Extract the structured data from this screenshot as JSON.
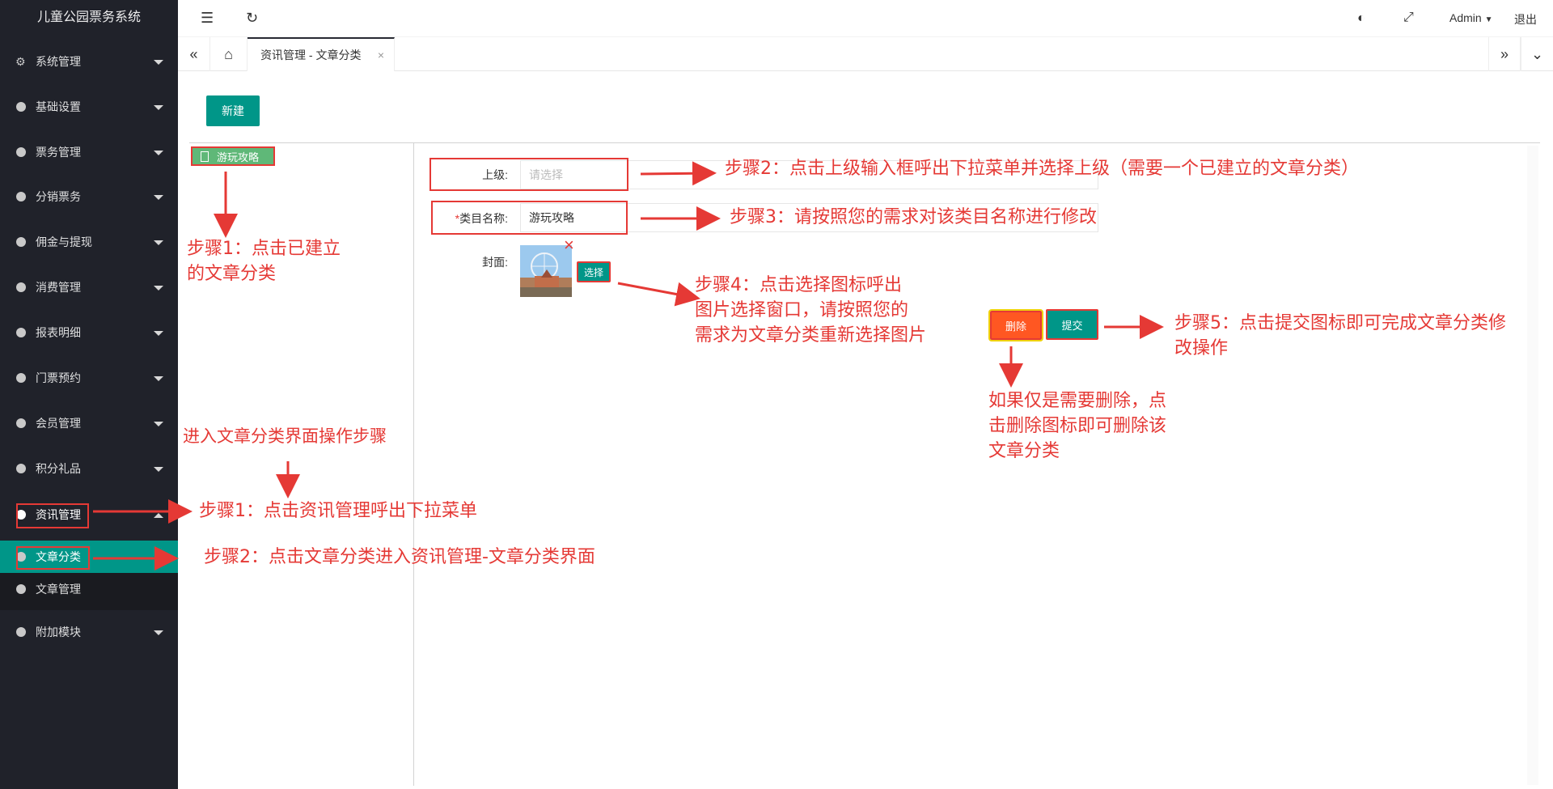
{
  "app": {
    "title": "儿童公园票务系统"
  },
  "sidebar": {
    "items": [
      {
        "label": "系统管理"
      },
      {
        "label": "基础设置"
      },
      {
        "label": "票务管理"
      },
      {
        "label": "分销票务"
      },
      {
        "label": "佣金与提现"
      },
      {
        "label": "消费管理"
      },
      {
        "label": "报表明细"
      },
      {
        "label": "门票预约"
      },
      {
        "label": "会员管理"
      },
      {
        "label": "积分礼品"
      },
      {
        "label": "资讯管理"
      },
      {
        "label": "附加模块"
      }
    ],
    "submenu": [
      {
        "label": "文章分类"
      },
      {
        "label": "文章管理"
      }
    ]
  },
  "header": {
    "user": "Admin",
    "logout": "退出"
  },
  "tabs": [
    {
      "label": "资讯管理 - 文章分类",
      "close": "×"
    }
  ],
  "toolbar": {
    "new_label": "新建"
  },
  "tree": {
    "node_label": "游玩攻略"
  },
  "form": {
    "parent_label": "上级:",
    "parent_placeholder": "请选择",
    "name_required": "*",
    "name_label": "类目名称:",
    "name_value": "游玩攻略",
    "cover_label": "封面:",
    "select_label": "选择",
    "remove_icon": "×",
    "delete_label": "删除",
    "submit_label": "提交"
  },
  "annotations": {
    "a1": "进入文章分类界面操作步骤",
    "a2": "步骤1：点击资讯管理呼出下拉菜单",
    "a3": "步骤2：点击文章分类进入资讯管理-文章分类界面",
    "a4_l1": "步骤1：点击已建立",
    "a4_l2": "的文章分类",
    "a5": "步骤2：点击上级输入框呼出下拉菜单并选择上级（需要一个已建立的文章分类）",
    "a6": "步骤3：请按照您的需求对该类目名称进行修改",
    "a7_l1": "步骤4：点击选择图标呼出",
    "a7_l2": "图片选择窗口，请按照您的",
    "a7_l3": "需求为文章分类重新选择图片",
    "a8_l1": "步骤5：点击提交图标即可完成文章分类修",
    "a8_l2": "改操作",
    "a9_l1": "如果仅是需要删除，点",
    "a9_l2": "击删除图标即可删除该",
    "a9_l3": "文章分类"
  },
  "colors": {
    "sidebar": "#20222a",
    "accent": "#009688",
    "annotation": "#e53935",
    "delete": "#ff5722",
    "tree_node": "#5fb878"
  }
}
